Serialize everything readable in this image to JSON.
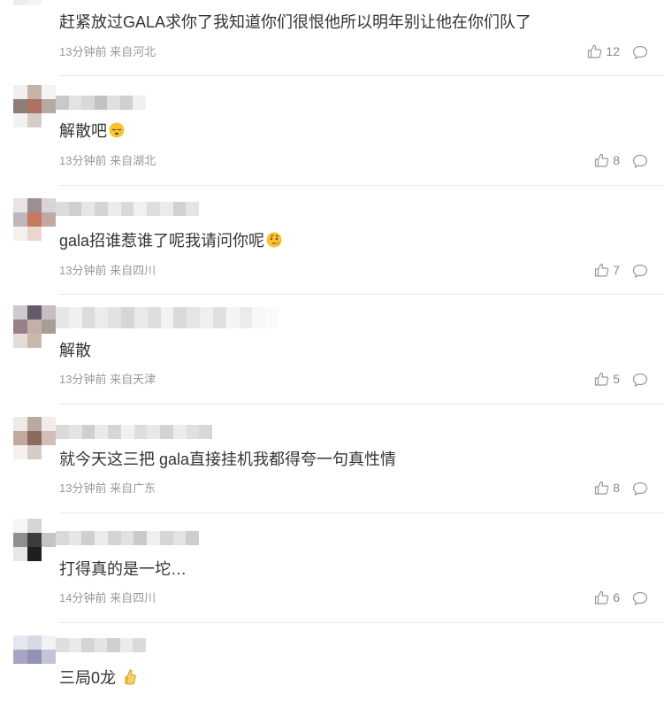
{
  "comments": [
    {
      "text": "赶紧放过GALA求你了我知道你们很恨他所以明年别让他在你们队了",
      "time": "13分钟前",
      "location": "来自河北",
      "likes": "12",
      "emoji": ""
    },
    {
      "text": "解散吧",
      "time": "13分钟前",
      "location": "来自湖北",
      "likes": "8",
      "emoji": "sleepy"
    },
    {
      "text": "gala招谁惹谁了呢我请问你呢",
      "time": "13分钟前",
      "location": "来自四川",
      "likes": "7",
      "emoji": "thinking"
    },
    {
      "text": "解散",
      "time": "13分钟前",
      "location": "来自天津",
      "likes": "5",
      "emoji": ""
    },
    {
      "text": "就今天这三把 gala直接挂机我都得夸一句真性情",
      "time": "13分钟前",
      "location": "来自广东",
      "likes": "8",
      "emoji": ""
    },
    {
      "text": "打得真的是一坨…",
      "time": "14分钟前",
      "location": "来自四川",
      "likes": "6",
      "emoji": ""
    },
    {
      "text": "三局0龙",
      "time": "",
      "location": "",
      "likes": "",
      "emoji": "thumb"
    }
  ],
  "colors": {
    "text": "#333333",
    "meta": "#999999",
    "divider": "#e8e8e8",
    "icon": "#999999"
  },
  "icons": {
    "like": "thumbs-up-icon",
    "reply": "comment-bubble-icon"
  }
}
